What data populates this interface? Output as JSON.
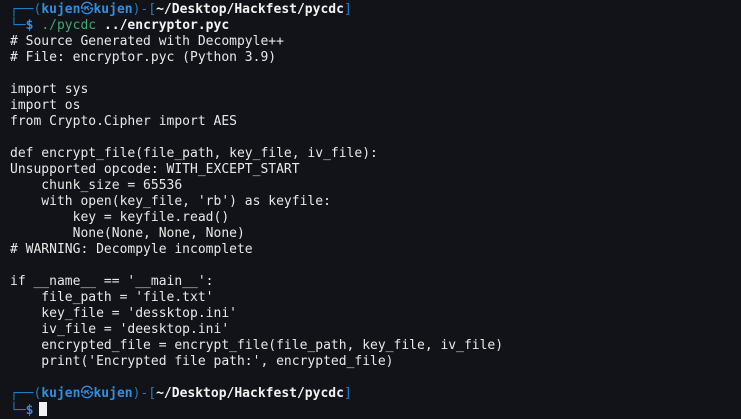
{
  "prompt": {
    "frame_top": "┌──(",
    "user": "kujen",
    "skull": "㉿",
    "host": "kujen",
    "close": ")-[",
    "path": "~/Desktop/Hackfest/pycdc",
    "end": "]",
    "frame_bottom": "└─",
    "dollar": "$"
  },
  "command": {
    "name": "./pycdc",
    "arg": "../encryptor.pyc"
  },
  "output": [
    "# Source Generated with Decompyle++",
    "# File: encryptor.pyc (Python 3.9)",
    "",
    "import sys",
    "import os",
    "from Crypto.Cipher import AES",
    "",
    "def encrypt_file(file_path, key_file, iv_file):",
    "Unsupported opcode: WITH_EXCEPT_START",
    "    chunk_size = 65536",
    "    with open(key_file, 'rb') as keyfile:",
    "        key = keyfile.read()",
    "        None(None, None, None)",
    "# WARNING: Decompyle incomplete",
    "",
    "if __name__ == '__main__':",
    "    file_path = 'file.txt'",
    "    key_file = 'dessktop.ini'",
    "    iv_file = 'deesktop.ini'",
    "    encrypted_file = encrypt_file(file_path, key_file, iv_file)",
    "    print('Encrypted file path:', encrypted_file)",
    ""
  ],
  "colors": {
    "background": "#111319",
    "prompt_frame": "#1c7fc2",
    "prompt_user": "#2f8fe0",
    "command": "#3fa86f",
    "text": "#e6e6e6"
  },
  "icons": {
    "cursor": "block-cursor"
  }
}
